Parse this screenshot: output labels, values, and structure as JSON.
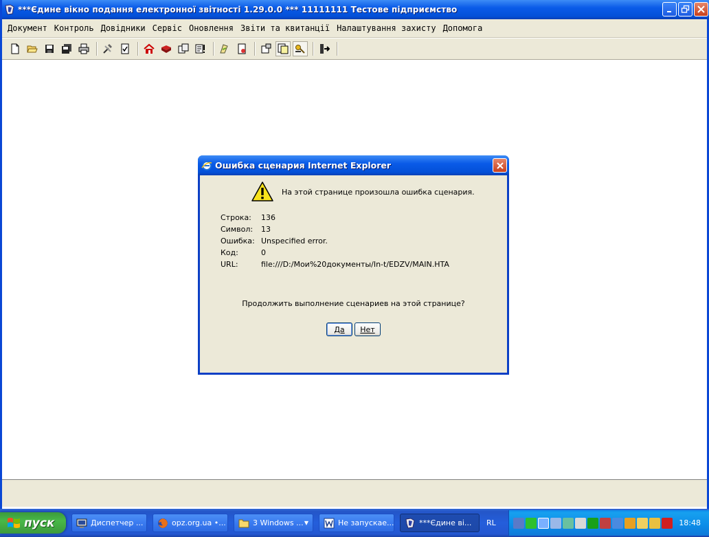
{
  "window": {
    "title": "***Єдине вікно подання електронної звітності 1.29.0.0 *** 11111111 Тестове підприємство"
  },
  "menubar": {
    "items": [
      "Документ",
      "Контроль",
      "Довідники",
      "Сервіс",
      "Оновлення",
      "Звіти та квитанції",
      "Налаштування захисту",
      "Допомога"
    ]
  },
  "toolbar": {
    "icons": [
      "new-document-icon",
      "open-folder-icon",
      "save-icon",
      "save-all-icon",
      "print-icon",
      "tools-icon",
      "check-document-icon",
      "home-icon",
      "book-icon",
      "copy-icon",
      "report-icon",
      "sign-icon",
      "certificate-icon",
      "settings-icon",
      "documents-icon",
      "key-icon",
      "exit-icon"
    ]
  },
  "dialog": {
    "title": "Ошибка сценария Internet Explorer",
    "message": "На этой странице произошла ошибка сценария.",
    "details": [
      {
        "label": "Строка:",
        "value": "136"
      },
      {
        "label": "Символ:",
        "value": "13"
      },
      {
        "label": "Ошибка:",
        "value": "Unspecified error."
      },
      {
        "label": "Код:",
        "value": "0"
      },
      {
        "label": "URL:",
        "value": "file:///D:/Мои%20документы/In-t/EDZV/MAIN.HTA"
      }
    ],
    "question": "Продолжить выполнение сценариев на этой странице?",
    "yes_label": "Да",
    "no_label": "Нет"
  },
  "taskbar": {
    "start_label": "пуск",
    "tasks": [
      {
        "label": "Диспетчер ...",
        "icon": "task-manager-icon"
      },
      {
        "label": "opz.org.ua •...",
        "icon": "firefox-icon"
      },
      {
        "label": "3 Windows ...",
        "icon": "folder-icon"
      },
      {
        "label": "Не запускае...",
        "icon": "word-icon"
      },
      {
        "label": "***Єдине ві...",
        "icon": "app-icon"
      }
    ],
    "language": "RL",
    "clock": "18:48"
  },
  "colors": {
    "titlebar_blue": "#0a5be8",
    "face": "#ece9d8",
    "start_green": "#48b848",
    "close_red": "#c8401d"
  }
}
